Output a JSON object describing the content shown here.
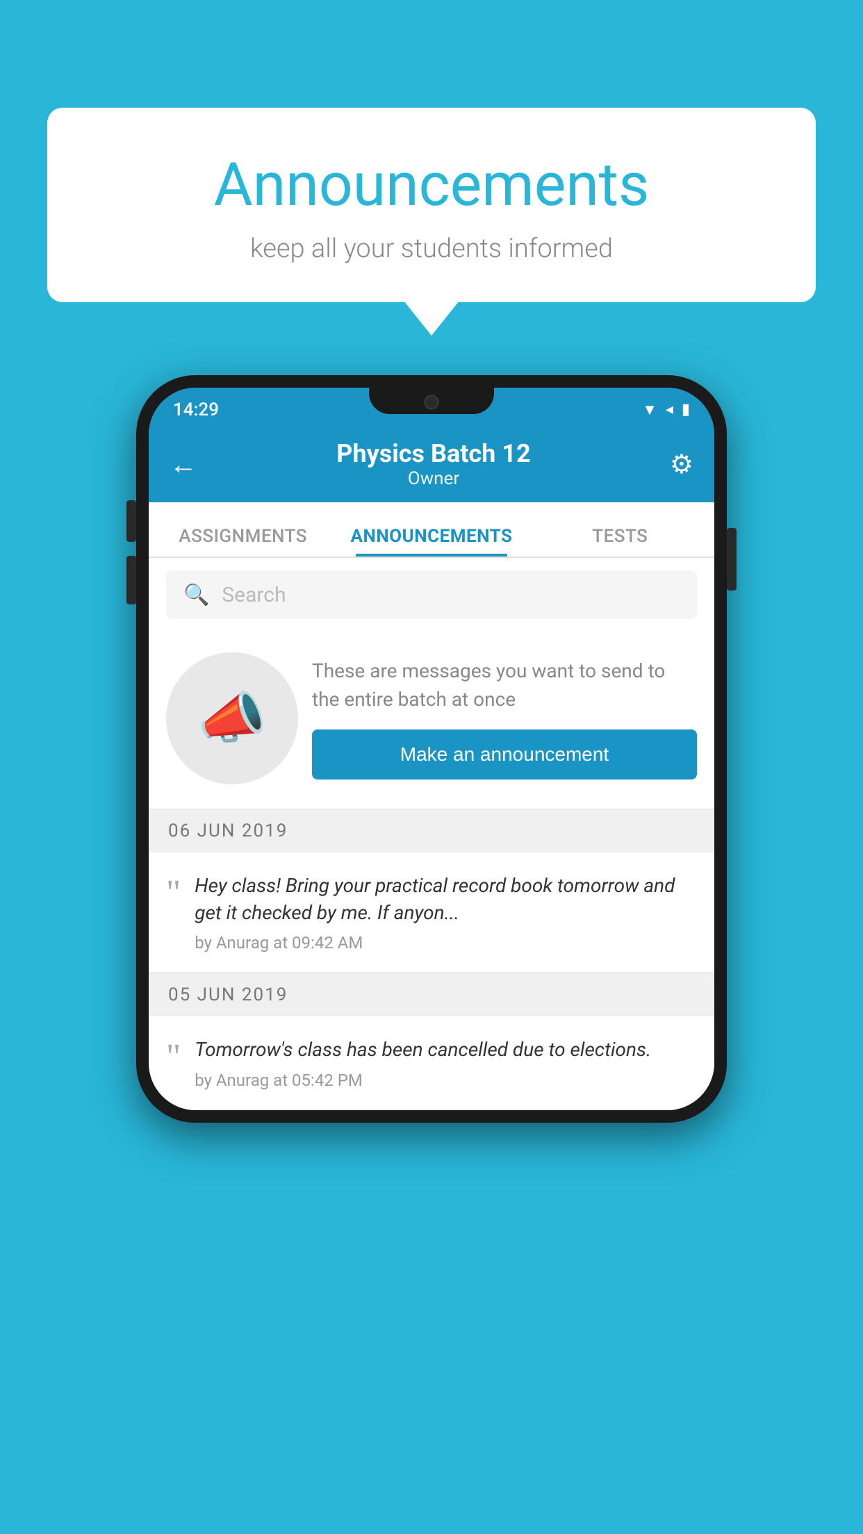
{
  "page": {
    "background_color": "#29b6d8"
  },
  "speech_bubble": {
    "title": "Announcements",
    "subtitle": "keep all your students informed"
  },
  "status_bar": {
    "time": "14:29",
    "wifi": "▲",
    "signal": "▲",
    "battery": "▉"
  },
  "app_bar": {
    "title": "Physics Batch 12",
    "subtitle": "Owner",
    "back_label": "←",
    "settings_label": "⚙"
  },
  "tabs": [
    {
      "label": "ASSIGNMENTS",
      "active": false
    },
    {
      "label": "ANNOUNCEMENTS",
      "active": true
    },
    {
      "label": "TESTS",
      "active": false
    }
  ],
  "search": {
    "placeholder": "Search"
  },
  "promo": {
    "description": "These are messages you want to send to the entire batch at once",
    "button_label": "Make an announcement"
  },
  "announcements": [
    {
      "date": "06  JUN  2019",
      "message": "Hey class! Bring your practical record book tomorrow and get it checked by me. If anyon...",
      "meta": "by Anurag at 09:42 AM"
    },
    {
      "date": "05  JUN  2019",
      "message": "Tomorrow's class has been cancelled due to elections.",
      "meta": "by Anurag at 05:42 PM"
    }
  ]
}
